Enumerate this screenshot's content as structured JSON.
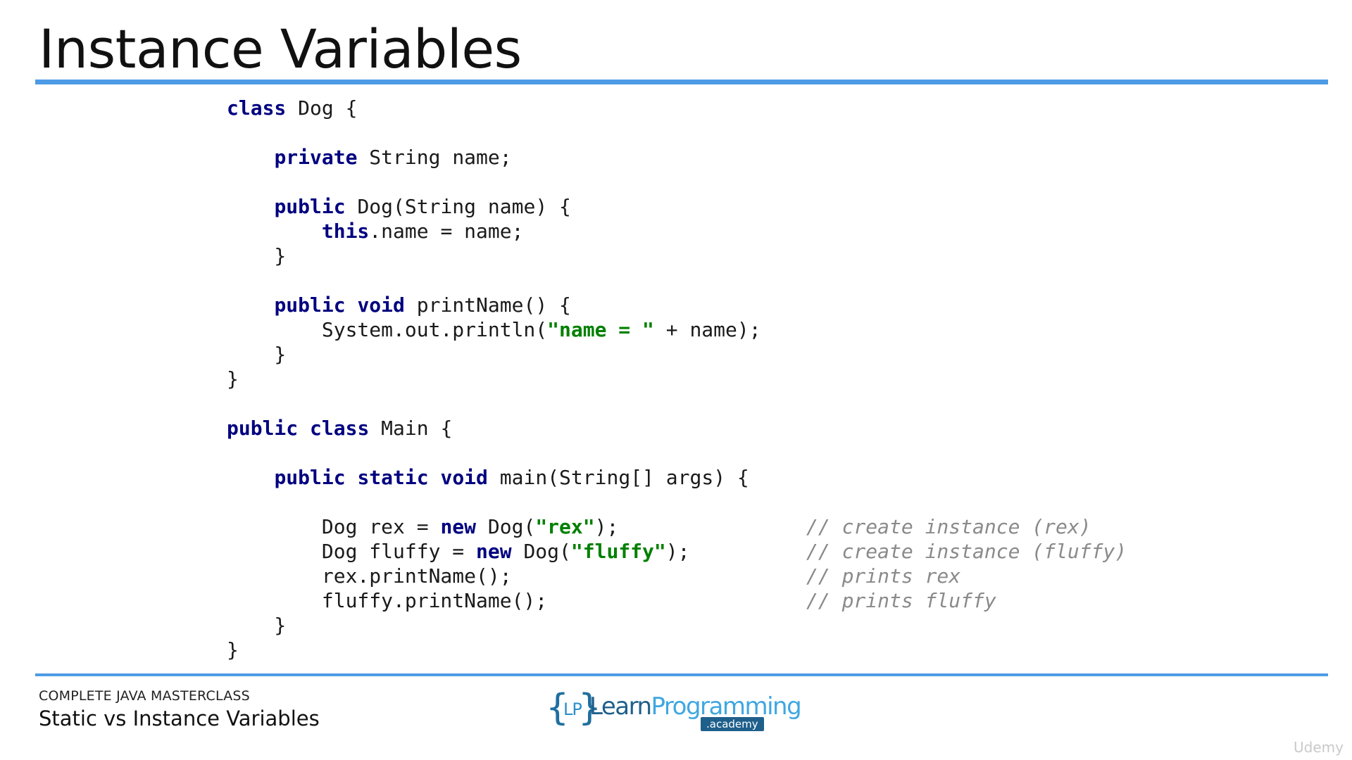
{
  "title": "Instance Variables",
  "colors": {
    "accent_rule": "#4d9be6",
    "keyword": "#000080",
    "string": "#008000",
    "comment": "#8a8a8a"
  },
  "code": {
    "lines": [
      [
        {
          "t": "class",
          "k": "kw"
        },
        {
          "t": " Dog {",
          "k": "txt"
        }
      ],
      [],
      [
        {
          "t": "    ",
          "k": "txt"
        },
        {
          "t": "private",
          "k": "kw"
        },
        {
          "t": " String name;",
          "k": "txt"
        }
      ],
      [],
      [
        {
          "t": "    ",
          "k": "txt"
        },
        {
          "t": "public",
          "k": "kw"
        },
        {
          "t": " Dog(String name) {",
          "k": "txt"
        }
      ],
      [
        {
          "t": "        ",
          "k": "txt"
        },
        {
          "t": "this",
          "k": "kw"
        },
        {
          "t": ".name = name;",
          "k": "txt"
        }
      ],
      [
        {
          "t": "    }",
          "k": "txt"
        }
      ],
      [],
      [
        {
          "t": "    ",
          "k": "txt"
        },
        {
          "t": "public",
          "k": "kw"
        },
        {
          "t": " ",
          "k": "txt"
        },
        {
          "t": "void",
          "k": "kw"
        },
        {
          "t": " printName() {",
          "k": "txt"
        }
      ],
      [
        {
          "t": "        System.out.println(",
          "k": "txt"
        },
        {
          "t": "\"name = \"",
          "k": "str"
        },
        {
          "t": " + name);",
          "k": "txt"
        }
      ],
      [
        {
          "t": "    }",
          "k": "txt"
        }
      ],
      [
        {
          "t": "}",
          "k": "txt"
        }
      ],
      [],
      [
        {
          "t": "public",
          "k": "kw"
        },
        {
          "t": " ",
          "k": "txt"
        },
        {
          "t": "class",
          "k": "kw"
        },
        {
          "t": " Main {",
          "k": "txt"
        }
      ],
      [],
      [
        {
          "t": "    ",
          "k": "txt"
        },
        {
          "t": "public",
          "k": "kw"
        },
        {
          "t": " ",
          "k": "txt"
        },
        {
          "t": "static",
          "k": "kw"
        },
        {
          "t": " ",
          "k": "txt"
        },
        {
          "t": "void",
          "k": "kw"
        },
        {
          "t": " main(String[] args) {",
          "k": "txt"
        }
      ],
      [],
      [
        {
          "t": "        Dog rex = ",
          "k": "txt"
        },
        {
          "t": "new",
          "k": "kw"
        },
        {
          "t": " Dog(",
          "k": "txt"
        },
        {
          "t": "\"rex\"",
          "k": "str"
        },
        {
          "t": ");",
          "k": "txt"
        }
      ],
      [
        {
          "t": "        Dog fluffy = ",
          "k": "txt"
        },
        {
          "t": "new",
          "k": "kw"
        },
        {
          "t": " Dog(",
          "k": "txt"
        },
        {
          "t": "\"fluffy\"",
          "k": "str"
        },
        {
          "t": ");",
          "k": "txt"
        }
      ],
      [
        {
          "t": "        rex.printName();",
          "k": "txt"
        }
      ],
      [
        {
          "t": "        fluffy.printName();",
          "k": "txt"
        }
      ],
      [
        {
          "t": "    }",
          "k": "txt"
        }
      ],
      [
        {
          "t": "}",
          "k": "txt"
        }
      ]
    ],
    "comments": [
      "",
      "",
      "",
      "",
      "",
      "",
      "",
      "",
      "",
      "",
      "",
      "",
      "",
      "",
      "",
      "",
      "",
      "// create instance (rex)",
      "// create instance (fluffy)",
      "// prints rex",
      "// prints fluffy",
      "",
      ""
    ]
  },
  "footer": {
    "course": "COMPLETE JAVA MASTERCLASS",
    "lecture": "Static vs Instance Variables"
  },
  "logo": {
    "brace_open": "{",
    "initials": "LP",
    "brace_close": "}",
    "word1": "Learn",
    "word2": "Programming",
    "sub": ".academy"
  },
  "watermark": "Udemy"
}
